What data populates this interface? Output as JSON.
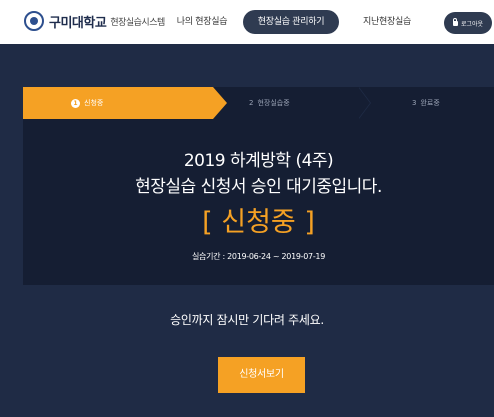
{
  "header": {
    "logo_name": "구미대학교",
    "logo_subtitle": "현장실습시스템",
    "nav_tabs": [
      {
        "label": "나의 현장실습",
        "active": false
      },
      {
        "label": "현장실습 관리하기",
        "active": true
      },
      {
        "label": "지난현장실습",
        "active": false
      }
    ],
    "logout_label": "로그아웃"
  },
  "steps": [
    {
      "number": "1",
      "label": "신청중",
      "active": true
    },
    {
      "number": "2",
      "label": "현장실습중",
      "active": false
    },
    {
      "number": "3",
      "label": "완료중",
      "active": false
    }
  ],
  "main": {
    "title_line1": "2019 하계방학 (4주)",
    "title_line2": "현장실습 신청서 승인 대기중입니다.",
    "status_text": "[ 신청중 ]",
    "period_text": "실습기간 : 2019-06-24 ~ 2019-07-19",
    "wait_message": "승인까지 잠시만 기다려 주세요.",
    "view_button_label": "신청서보기"
  },
  "colors": {
    "accent": "#f5a124",
    "band": "#1f2b45",
    "card": "#151e33",
    "nav_active": "#2f3b51"
  }
}
